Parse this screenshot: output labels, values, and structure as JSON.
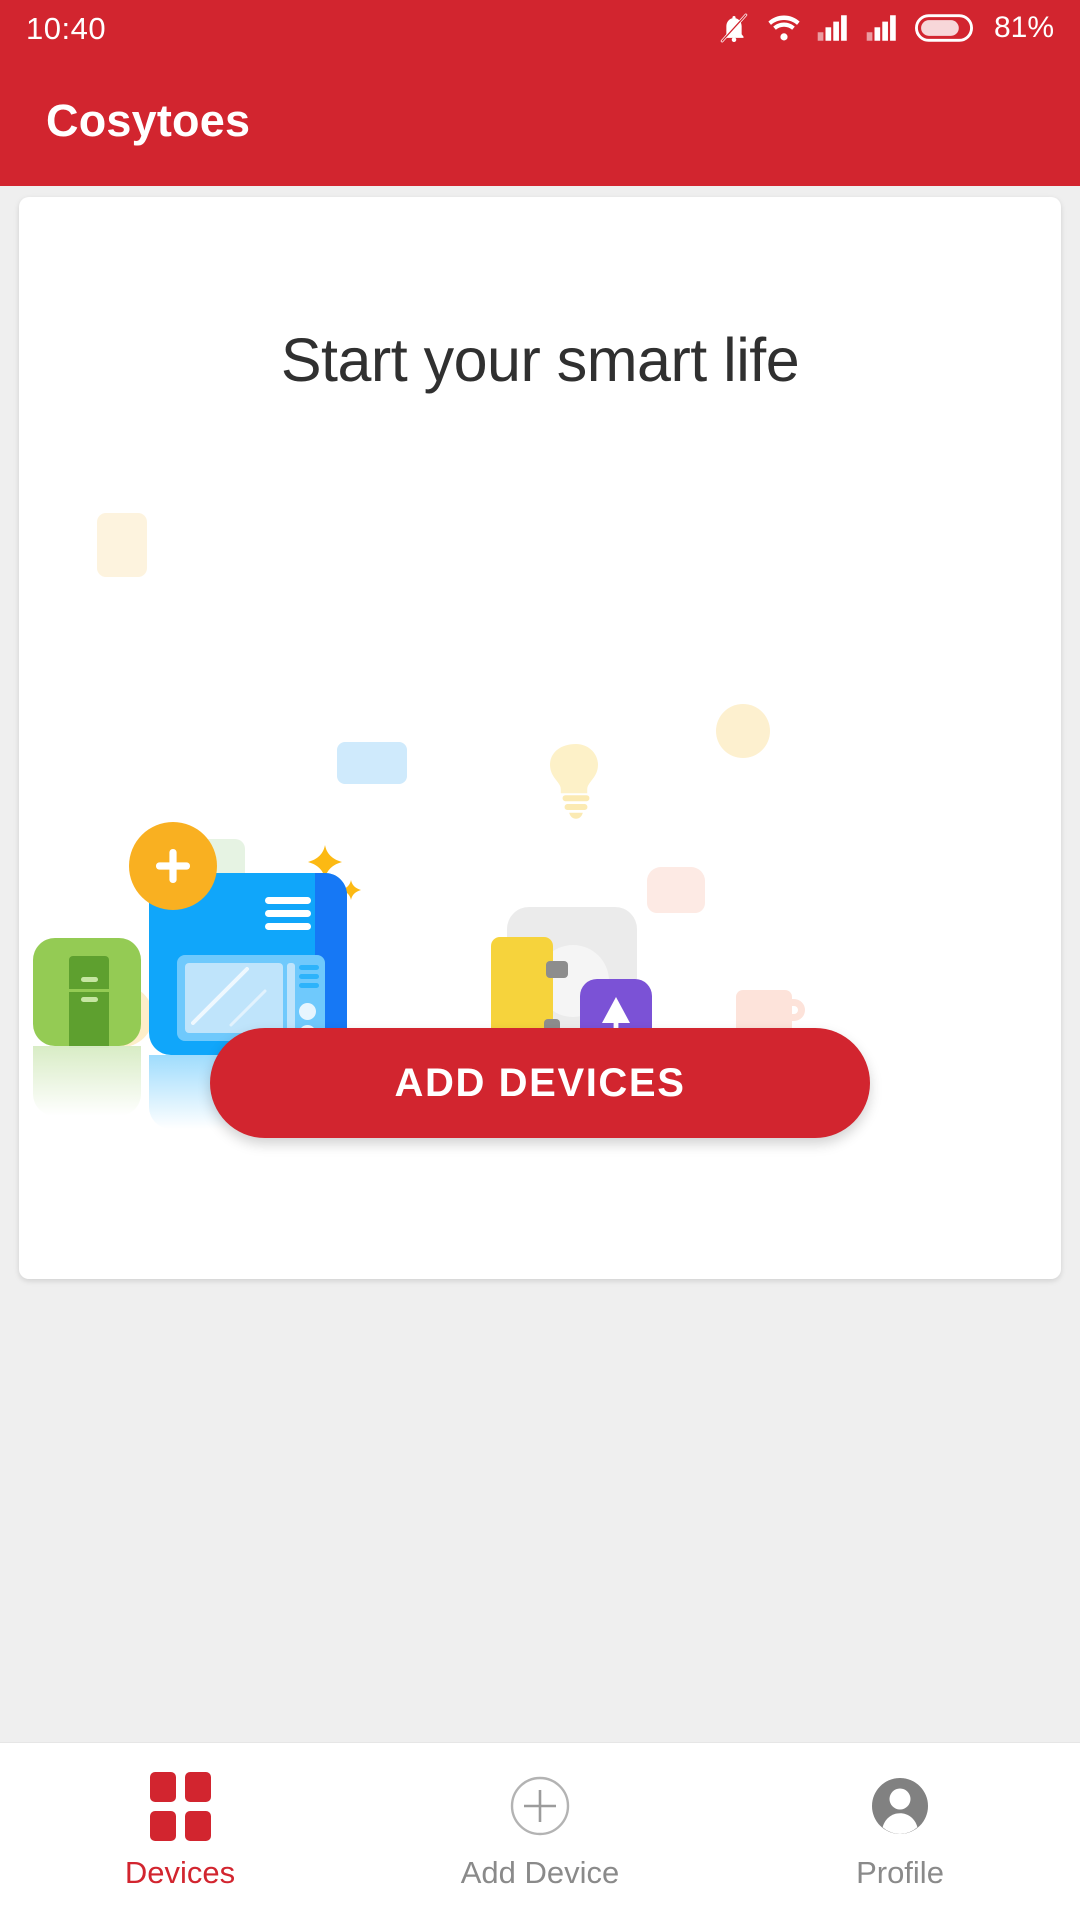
{
  "status_bar": {
    "time": "10:40",
    "battery_percent": "81%",
    "icons": [
      "bell-mute-icon",
      "wifi-icon",
      "signal-sim1-icon",
      "signal-sim2-icon",
      "battery-icon"
    ]
  },
  "app_bar": {
    "title": "Cosytoes",
    "background_color": "#d2252f"
  },
  "card": {
    "headline": "Start your smart life",
    "illustration": {
      "name": "smart-home-devices-illustration",
      "elements": [
        {
          "name": "add-badge-icon",
          "color": "#f9b021",
          "symbol": "+"
        },
        {
          "name": "microwave-device-tile",
          "color": "#10a6fa"
        },
        {
          "name": "refrigerator-device-tile",
          "color": "#94cb54"
        },
        {
          "name": "lamp-device-tile",
          "color": "#7b52d6"
        },
        {
          "name": "washer-device-tile",
          "color": "#e8e8e8"
        },
        {
          "name": "toaster-device-accent",
          "color": "#f6d33c"
        },
        {
          "name": "sparkle-icon",
          "color": "#fcb913"
        },
        {
          "name": "faded-bulb-icon",
          "color": "#fdf1c8"
        },
        {
          "name": "faded-square-yellow",
          "color": "#fdf4e0"
        },
        {
          "name": "faded-square-blue",
          "color": "#cfeafc"
        },
        {
          "name": "faded-square-green",
          "color": "#e5f3e2"
        },
        {
          "name": "faded-circle-yellow",
          "color": "#fdeec9"
        },
        {
          "name": "faded-circle-peach",
          "color": "#fdeae4"
        },
        {
          "name": "faded-kettle-icon",
          "color": "#fde3da"
        }
      ]
    },
    "cta_label": "ADD DEVICES",
    "cta_color": "#d2252f"
  },
  "bottom_nav": {
    "active_index": 0,
    "active_color": "#d2252f",
    "inactive_color": "#8a8a8a",
    "items": [
      {
        "label": "Devices",
        "icon": "grid-squares-icon"
      },
      {
        "label": "Add Device",
        "icon": "circle-plus-icon"
      },
      {
        "label": "Profile",
        "icon": "person-avatar-icon"
      }
    ]
  }
}
